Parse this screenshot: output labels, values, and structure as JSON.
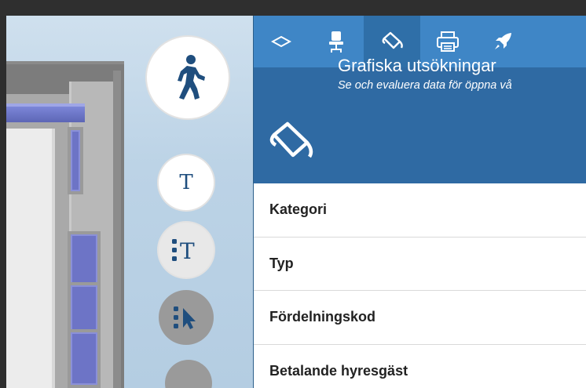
{
  "tabs": [
    {
      "icon": "layers-icon",
      "active": false
    },
    {
      "icon": "office-chair-icon",
      "active": false
    },
    {
      "icon": "paint-bucket-icon",
      "active": true
    },
    {
      "icon": "printer-icon",
      "active": false
    },
    {
      "icon": "rocket-icon",
      "active": false
    }
  ],
  "header": {
    "title": "Grafiska utsökningar",
    "subtitle": "Se och evaluera data för öppna vå"
  },
  "fields": [
    {
      "label": "Kategori"
    },
    {
      "label": "Typ"
    },
    {
      "label": "Fördelningskod"
    },
    {
      "label": "Betalande hyresgäst"
    }
  ],
  "tools": {
    "text_glyph": "T"
  },
  "colors": {
    "tab_bar": "#3f86c6",
    "tab_active": "#2f6fa8",
    "header_bg": "#2f6aa3",
    "tool_icon": "#1f4e7e"
  }
}
